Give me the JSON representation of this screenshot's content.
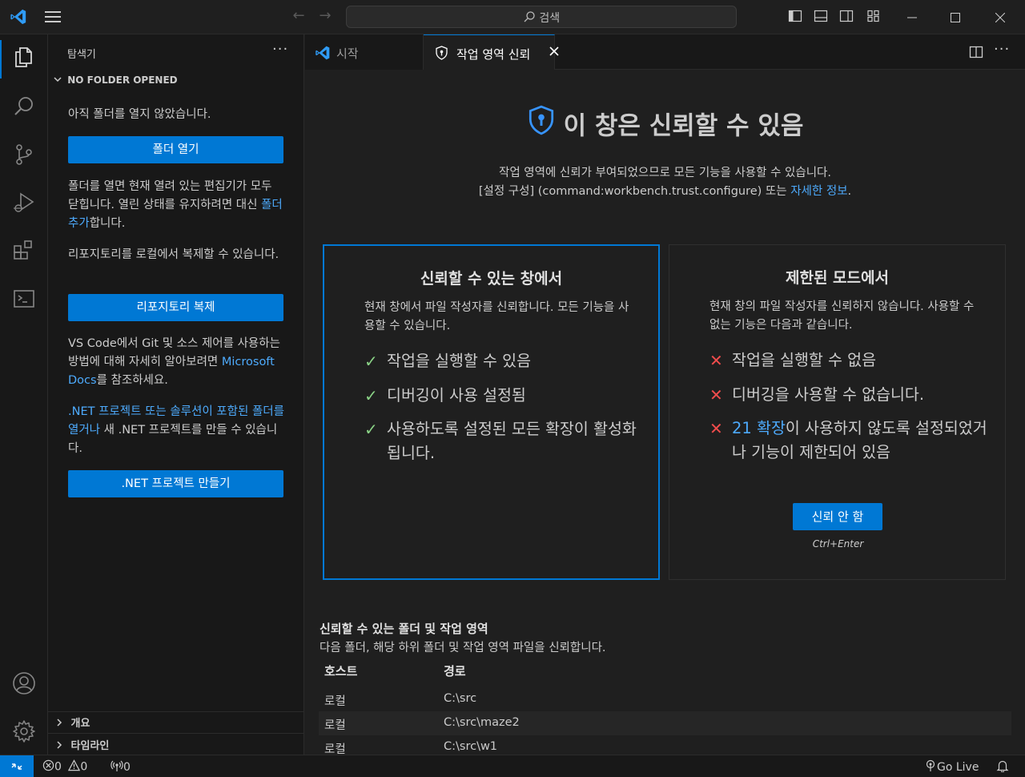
{
  "titlebar": {
    "search_text": "검색"
  },
  "tabs": [
    {
      "label": "시작"
    },
    {
      "label": "작업 영역 신뢰"
    }
  ],
  "sidebar": {
    "title": "탐색기",
    "section": "NO FOLDER OPENED",
    "no_folder_text": "아직 폴더를 열지 않았습니다.",
    "open_folder_button": "폴더 열기",
    "open_folder_note": {
      "before": "폴더를 열면 현재 열려 있는 편집기가 모두 닫힙니다. 열린 상태를 유지하려면 대신 ",
      "link": "폴더 추가",
      "after": "합니다."
    },
    "clone_text": "리포지토리를 로컬에서 복제할 수 있습니다.",
    "clone_button": "리포지토리 복제",
    "git_text": {
      "before": "VS Code에서 Git 및 소스 제어를 사용하는 방법에 대해 자세히 알아보려면 ",
      "link": "Microsoft Docs",
      "after": "를 참조하세요."
    },
    "dotnet_text": {
      "link": ".NET 프로젝트 또는 솔루션이 포함된 폴더를 열거나",
      "after": " 새 .NET 프로젝트를 만들 수 있습니다."
    },
    "dotnet_button": ".NET 프로젝트 만들기",
    "outline_label": "개요",
    "timeline_label": "타임라인"
  },
  "trust": {
    "title": "이 창은 신뢰할 수 있음",
    "desc_line1": "작업 영역에 신뢰가 부여되었으므로 모든 기능을 사용할 수 있습니다.",
    "desc_line2_before": "[설정 구성] (command:workbench.trust.configure) 또는 ",
    "desc_line2_link": "자세한 정보",
    "desc_line2_after": ".",
    "trusted_card": {
      "title": "신뢰할 수 있는 창에서",
      "desc": "현재 창에서 파일 작성자를 신뢰합니다. 모든 기능을 사용할 수 있습니다.",
      "features": [
        "작업을 실행할 수 있음",
        "디버깅이 사용 설정됨",
        "사용하도록 설정된 모든 확장이 활성화됩니다."
      ]
    },
    "restricted_card": {
      "title": "제한된 모드에서",
      "desc": "현재 창의 파일 작성자를 신뢰하지 않습니다. 사용할 수 없는 기능은 다음과 같습니다.",
      "features": [
        "작업을 실행할 수 없음",
        "디버깅을 사용할 수 없습니다.",
        "이 사용하지 않도록 설정되었거나 기능이 제한되어 있음"
      ],
      "extensions_link": "21 확장",
      "button": "신뢰 안 함",
      "shortcut": "Ctrl+Enter"
    },
    "folders_title": "신뢰할 수 있는 폴더 및 작업 영역",
    "folders_desc": "다음 폴더, 해당 하위 폴더 및 작업 영역 파일을 신뢰합니다.",
    "columns": [
      "호스트",
      "경로"
    ],
    "rows": [
      {
        "host": "로컬",
        "path": "C:\\src"
      },
      {
        "host": "로컬",
        "path": "C:\\src\\maze2"
      },
      {
        "host": "로컬",
        "path": "C:\\src\\w1"
      }
    ]
  },
  "statusbar": {
    "errors": "0",
    "warnings": "0",
    "ports": "0",
    "go_live": "Go Live"
  },
  "colors": {
    "accent": "#0078d4",
    "link": "#4daafc",
    "check": "#89d185",
    "cross": "#f14c4c"
  }
}
